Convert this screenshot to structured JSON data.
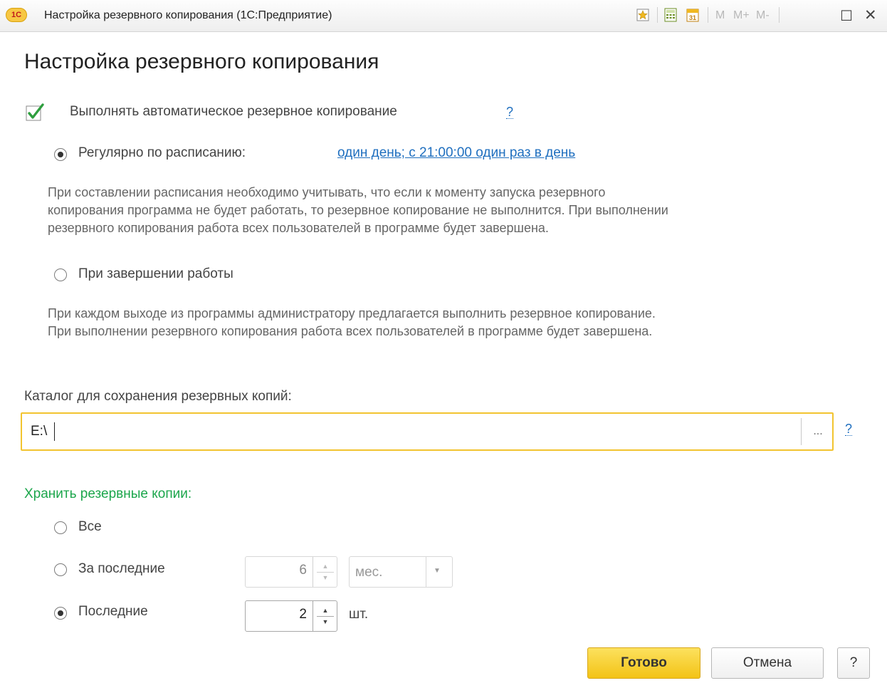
{
  "window": {
    "logo_text": "1C",
    "title": "Настройка резервного копирования  (1С:Предприятие)",
    "m_buttons": [
      "M",
      "M+",
      "M-"
    ],
    "calendar_day": "31",
    "close_glyph": "✕",
    "maximize_glyph": "☐"
  },
  "form": {
    "title": "Настройка резервного копирования",
    "auto_backup": {
      "checked": true,
      "label": "Выполнять автоматическое резервное копирование",
      "help": "?"
    },
    "schedule_option": {
      "selected": true,
      "label": "Регулярно по расписанию:",
      "link": "один день; с 21:00:00 один раз в день",
      "description_lines": [
        "При составлении расписания необходимо учитывать, что если к моменту запуска резервного",
        "копирования программа не будет работать, то резервное копирование не выполнится. При выполнении",
        "резервного копирования работа всех пользователей в программе будет завершена."
      ]
    },
    "exit_option": {
      "selected": false,
      "label": "При завершении работы",
      "description_lines": [
        "При каждом выходе из программы администратору предлагается выполнить резервное копирование.",
        "При выполнении резервного копирования работа всех пользователей в программе будет завершена."
      ]
    },
    "catalog": {
      "label": "Каталог для сохранения резервных копий:",
      "value": "E:\\",
      "browse": "...",
      "help": "?"
    },
    "keep": {
      "title": "Хранить резервные копии:",
      "all": {
        "label": "Все",
        "selected": false
      },
      "last_period": {
        "label": "За последние",
        "selected": false,
        "count": "6",
        "unit": "мес."
      },
      "last_count": {
        "label": "Последние",
        "selected": true,
        "count": "2",
        "unit": "шт."
      }
    },
    "buttons": {
      "done": "Готово",
      "cancel": "Отмена",
      "help": "?"
    }
  },
  "colors": {
    "accent_yellow": "#f2c430",
    "link_blue": "#1f6fbf",
    "section_green": "#1ca64c",
    "check_green": "#2e9e3e"
  }
}
